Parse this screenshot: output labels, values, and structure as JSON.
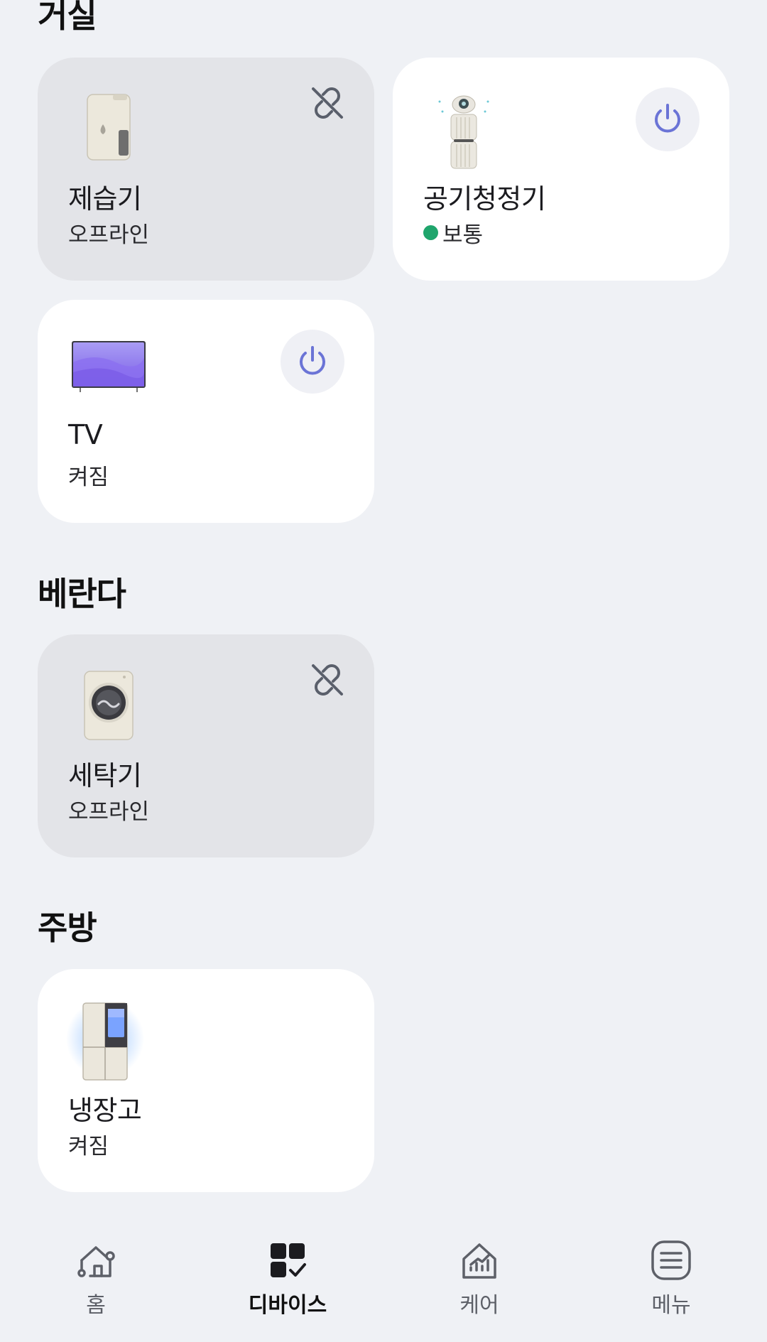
{
  "rooms": [
    {
      "name": "거실",
      "devices": [
        {
          "name": "제습기",
          "status": "오프라인",
          "online": false,
          "icon": "dehumidifier-icon"
        },
        {
          "name": "공기청정기",
          "status": "보통",
          "online": true,
          "status_color": "#1fa56c",
          "icon": "air-purifier-icon"
        },
        {
          "name": "TV",
          "status": "켜짐",
          "online": true,
          "icon": "tv-icon"
        }
      ]
    },
    {
      "name": "베란다",
      "devices": [
        {
          "name": "세탁기",
          "status": "오프라인",
          "online": false,
          "icon": "washing-machine-icon"
        }
      ]
    },
    {
      "name": "주방",
      "devices": [
        {
          "name": "냉장고",
          "status": "켜짐",
          "online": true,
          "icon": "refrigerator-icon"
        }
      ]
    }
  ],
  "bottom_nav": {
    "items": [
      {
        "label": "홈",
        "icon": "home-icon",
        "active": false
      },
      {
        "label": "디바이스",
        "icon": "devices-icon",
        "active": true
      },
      {
        "label": "케어",
        "icon": "care-icon",
        "active": false
      },
      {
        "label": "메뉴",
        "icon": "menu-icon",
        "active": false
      }
    ]
  },
  "colors": {
    "background": "#eff1f5",
    "card": "#ffffff",
    "card_offline": "#e3e4e8",
    "power_accent": "#6b74d6",
    "status_green": "#1fa56c"
  }
}
